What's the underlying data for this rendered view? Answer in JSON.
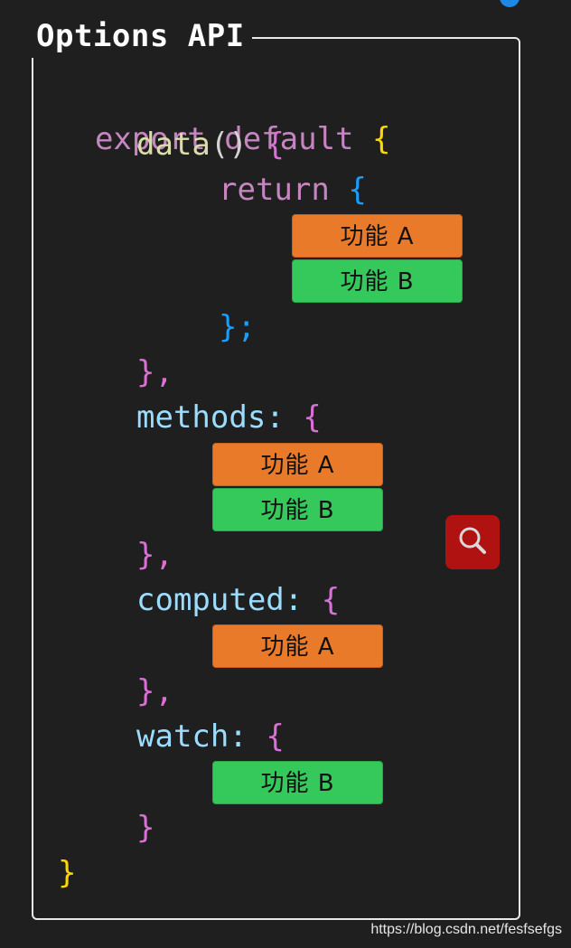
{
  "panel": {
    "title": "Options API"
  },
  "code": {
    "export_kw": "export default",
    "open_brace": "{",
    "data_fn": "data",
    "data_parens": "()",
    "return_kw": "return",
    "return_close": "};",
    "block_close": "},",
    "methods_key": "methods:",
    "computed_key": "computed:",
    "watch_key": "watch:",
    "close_brace": "}"
  },
  "features": {
    "data_a": "功能 A",
    "data_b": "功能 B",
    "methods_a": "功能 A",
    "methods_b": "功能 B",
    "computed_a": "功能 A",
    "watch_b": "功能 B"
  },
  "colors": {
    "feature_a": "#e87a2a",
    "feature_b": "#35c85b",
    "search_button": "#b01212"
  },
  "icons": {
    "search": "search-icon"
  },
  "watermark": "https://blog.csdn.net/fesfsefgs"
}
